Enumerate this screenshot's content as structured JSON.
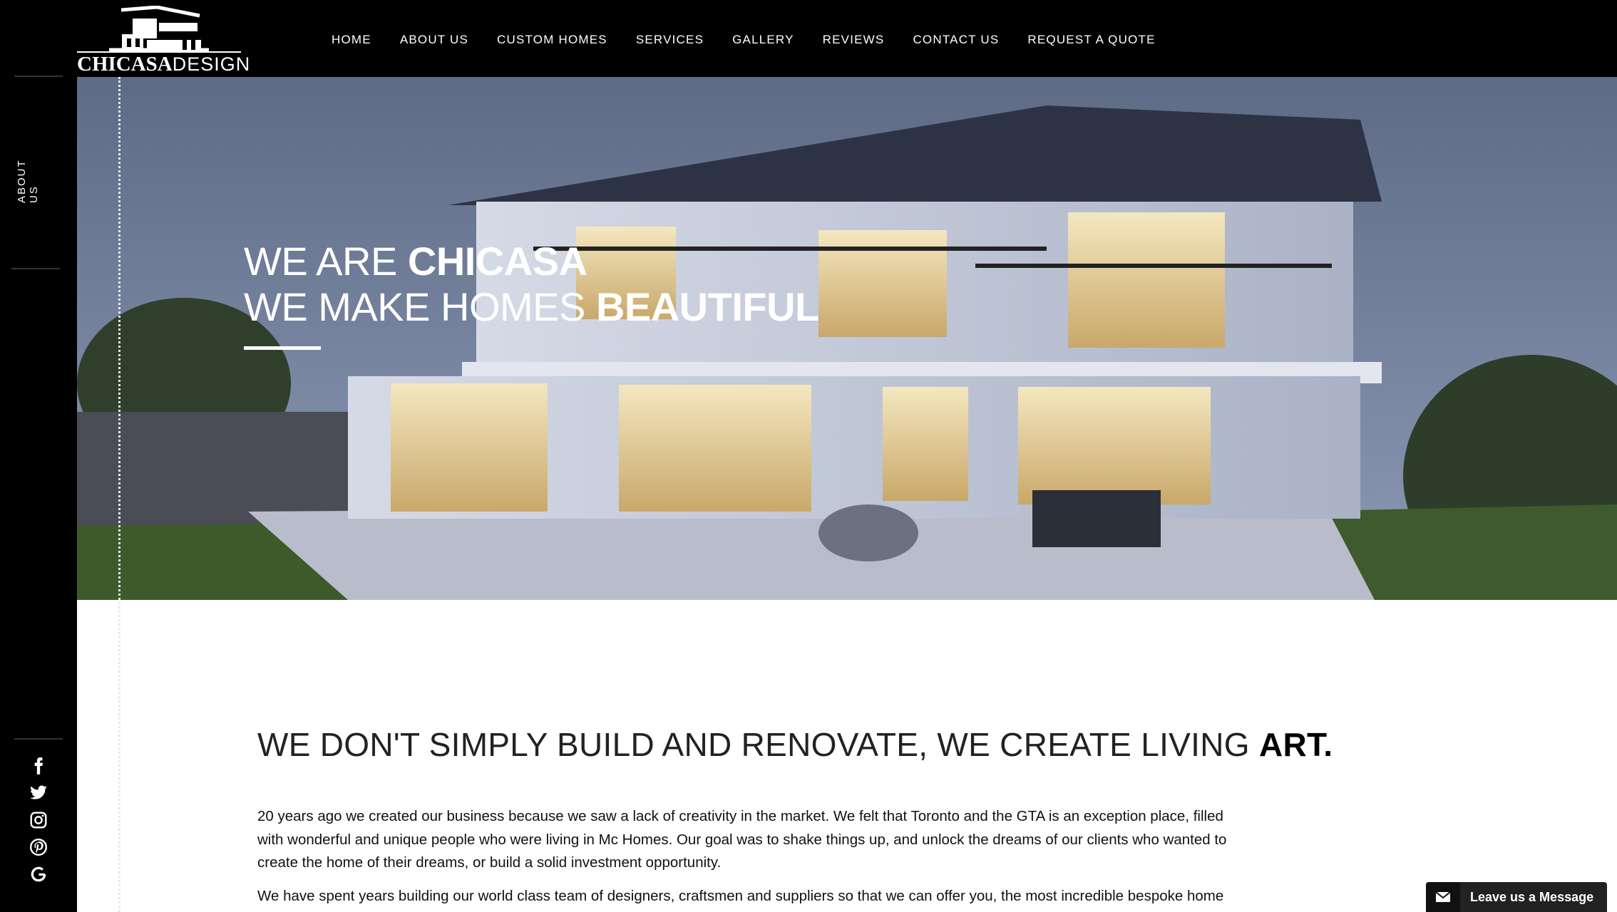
{
  "brand": {
    "logo_bold": "CHICASA",
    "logo_light": "DESIGN"
  },
  "nav": {
    "items": [
      "HOME",
      "ABOUT US",
      "CUSTOM HOMES",
      "SERVICES",
      "GALLERY",
      "REVIEWS",
      "CONTACT US",
      "REQUEST A QUOTE"
    ]
  },
  "sidebar": {
    "label": "ABOUT US",
    "social_icons": [
      "facebook-icon",
      "twitter-icon",
      "instagram-icon",
      "pinterest-icon",
      "google-icon"
    ]
  },
  "hero": {
    "line1_light": "WE ARE ",
    "line1_bold": "CHICASA",
    "line2_light": "WE MAKE HOMES ",
    "line2_bold": "BEAUTIFUL"
  },
  "intro": {
    "tagline_light": "WE DON'T SIMPLY BUILD AND RENOVATE, WE CREATE LIVING ",
    "tagline_bold": "ART.",
    "paragraph1": "20 years ago we created our business because we saw a lack of creativity in the market. We felt that Toronto and the GTA is an exception place, filled with wonderful and unique people who were living in Mc Homes. Our goal was to shake things up, and unlock the dreams of our clients who wanted to create the home of their dreams, or build a solid investment opportunity.",
    "paragraph2": "We have spent years building our world class team of designers, craftsmen and suppliers so that we can offer you, the most incredible bespoke home"
  },
  "chat": {
    "label": "Leave us a Message",
    "icon": "envelope-icon"
  },
  "colors": {
    "bar": "#000000",
    "text": "#111111",
    "accent": "#ffffff"
  }
}
